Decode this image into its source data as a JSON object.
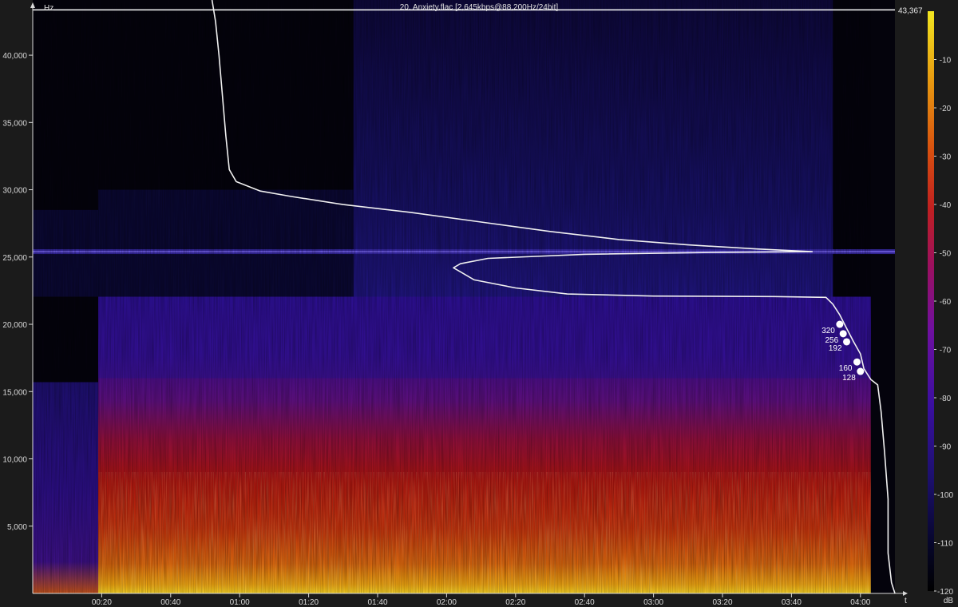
{
  "chart_data": {
    "type": "heatmap",
    "title": "20. Anxiety.flac [2,645kbps@88,200Hz/24bit]",
    "xlabel": "t",
    "ylabel": "Hz",
    "colorbar_label": "dB",
    "x_unit": "mm:ss",
    "xlim": [
      "00:00",
      "04:10"
    ],
    "ylim": [
      0,
      44100
    ],
    "x_ticks": [
      "00:20",
      "00:40",
      "01:00",
      "01:20",
      "01:40",
      "02:00",
      "02:20",
      "02:40",
      "03:00",
      "03:20",
      "03:40",
      "04:00"
    ],
    "y_ticks": [
      "5,000",
      "10,000",
      "15,000",
      "20,000",
      "25,000",
      "30,000",
      "35,000",
      "40,000"
    ],
    "colorbar_ticks": [
      "-10",
      "-20",
      "-30",
      "-40",
      "-50",
      "-60",
      "-70",
      "-80",
      "-90",
      "-100",
      "-110",
      "-120"
    ],
    "colorbar_range": [
      -120,
      0
    ],
    "reference_line": {
      "value": 43367,
      "label": "43,367"
    },
    "content_bands": [
      {
        "from": "00:00",
        "to": "00:19",
        "cutoff_hz": 15700
      },
      {
        "from": "00:19",
        "to": "04:03",
        "cutoff_hz": 22050
      },
      {
        "from": "04:03",
        "to": "04:10",
        "cutoff_hz": 0
      }
    ],
    "noise_band_hz": 25400,
    "cutoff_curve": [
      [
        "00:52",
        44100
      ],
      [
        "00:53",
        42500
      ],
      [
        "00:54",
        40000
      ],
      [
        "00:55",
        37000
      ],
      [
        "00:56",
        34000
      ],
      [
        "00:57",
        31500
      ],
      [
        "00:59",
        30600
      ],
      [
        "01:06",
        29900
      ],
      [
        "01:15",
        29500
      ],
      [
        "01:30",
        28900
      ],
      [
        "01:50",
        28300
      ],
      [
        "02:10",
        27600
      ],
      [
        "02:30",
        26900
      ],
      [
        "02:50",
        26300
      ],
      [
        "03:10",
        25900
      ],
      [
        "03:30",
        25600
      ],
      [
        "03:46",
        25400
      ],
      [
        "03:20",
        25350
      ],
      [
        "02:40",
        25200
      ],
      [
        "02:12",
        24900
      ],
      [
        "02:04",
        24500
      ],
      [
        "02:02",
        24200
      ],
      [
        "02:04",
        23900
      ],
      [
        "02:08",
        23300
      ],
      [
        "02:20",
        22700
      ],
      [
        "02:35",
        22250
      ],
      [
        "03:00",
        22100
      ],
      [
        "03:35",
        22060
      ],
      [
        "03:50",
        22000
      ],
      [
        "03:52",
        21500
      ],
      [
        "03:54",
        20700
      ],
      [
        "03:56",
        19700
      ],
      [
        "03:58",
        18700
      ],
      [
        "04:00",
        17800
      ],
      [
        "04:01",
        16700
      ],
      [
        "04:03",
        15900
      ],
      [
        "04:05",
        15500
      ],
      [
        "04:06",
        13500
      ],
      [
        "04:07",
        10500
      ],
      [
        "04:08",
        7000
      ],
      [
        "04:08",
        3000
      ],
      [
        "04:09",
        800
      ],
      [
        "04:10",
        0
      ]
    ],
    "bitrate_markers": [
      {
        "label": "320",
        "t": "03:54",
        "hz": 20000
      },
      {
        "label": "256",
        "t": "03:55",
        "hz": 19300
      },
      {
        "label": "192",
        "t": "03:56",
        "hz": 18700
      },
      {
        "label": "160",
        "t": "03:59",
        "hz": 17200
      },
      {
        "label": "128",
        "t": "04:00",
        "hz": 16500
      }
    ]
  }
}
